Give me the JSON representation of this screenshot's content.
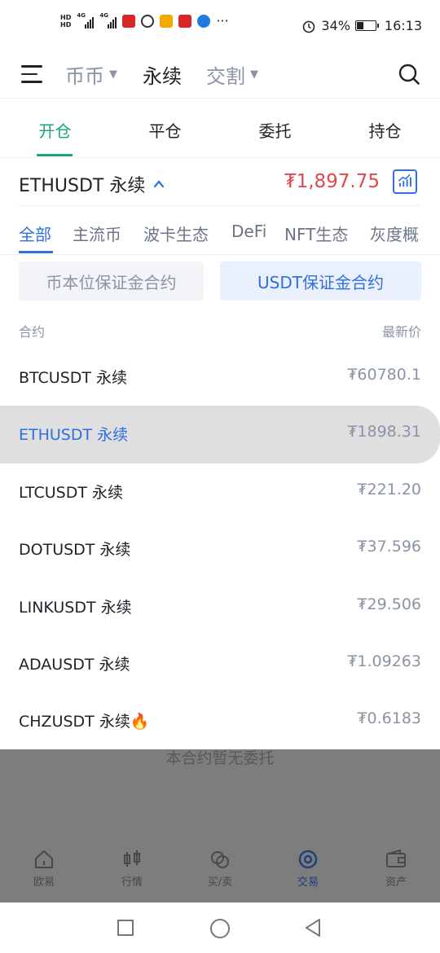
{
  "status_bar": {
    "battery": "34%",
    "battery_level": 0.34,
    "time": "16:13",
    "network_labels": [
      "HD",
      "HD",
      "4G",
      "4G"
    ]
  },
  "header": {
    "tabs": [
      {
        "label": "币币",
        "has_caret": true
      },
      {
        "label": "永续",
        "has_caret": false,
        "active": true
      },
      {
        "label": "交割",
        "has_caret": true
      }
    ],
    "menu_icon": "hamburger-icon",
    "search_icon": "search-icon"
  },
  "sub_tabs": [
    "开仓",
    "平仓",
    "委托",
    "持仓"
  ],
  "panel": {
    "pair_name": "ETHUSDT 永续",
    "pair_price": "₮1,897.75",
    "categories": [
      "全部",
      "主流币",
      "波卡生态",
      "DeFi",
      "NFT生态",
      "灰度概"
    ],
    "segments": [
      "币本位保证金合约",
      "USDT保证金合约"
    ],
    "col_contract": "合约",
    "col_price": "最新价",
    "rows": [
      {
        "name": "BTCUSDT 永续",
        "price": "₮60780.1"
      },
      {
        "name": "ETHUSDT 永续",
        "price": "₮1898.31",
        "selected": true
      },
      {
        "name": "LTCUSDT 永续",
        "price": "₮221.20"
      },
      {
        "name": "DOTUSDT 永续",
        "price": "₮37.596"
      },
      {
        "name": "LINKUSDT 永续",
        "price": "₮29.506"
      },
      {
        "name": "ADAUSDT 永续",
        "price": "₮1.09263"
      },
      {
        "name": "CHZUSDT 永续🔥",
        "price": "₮0.6183"
      }
    ]
  },
  "behind": {
    "empty_text": "本合约暂无委托"
  },
  "tab_bar": [
    {
      "label": "欧易",
      "icon": "home-icon"
    },
    {
      "label": "行情",
      "icon": "candlestick-icon"
    },
    {
      "label": "买/卖",
      "icon": "coins-icon"
    },
    {
      "label": "交易",
      "icon": "trade-icon",
      "active": true
    },
    {
      "label": "资产",
      "icon": "wallet-icon"
    }
  ],
  "colors": {
    "accent_green": "#16a77c",
    "accent_blue": "#2f6fe0",
    "price_red": "#e0484b"
  }
}
